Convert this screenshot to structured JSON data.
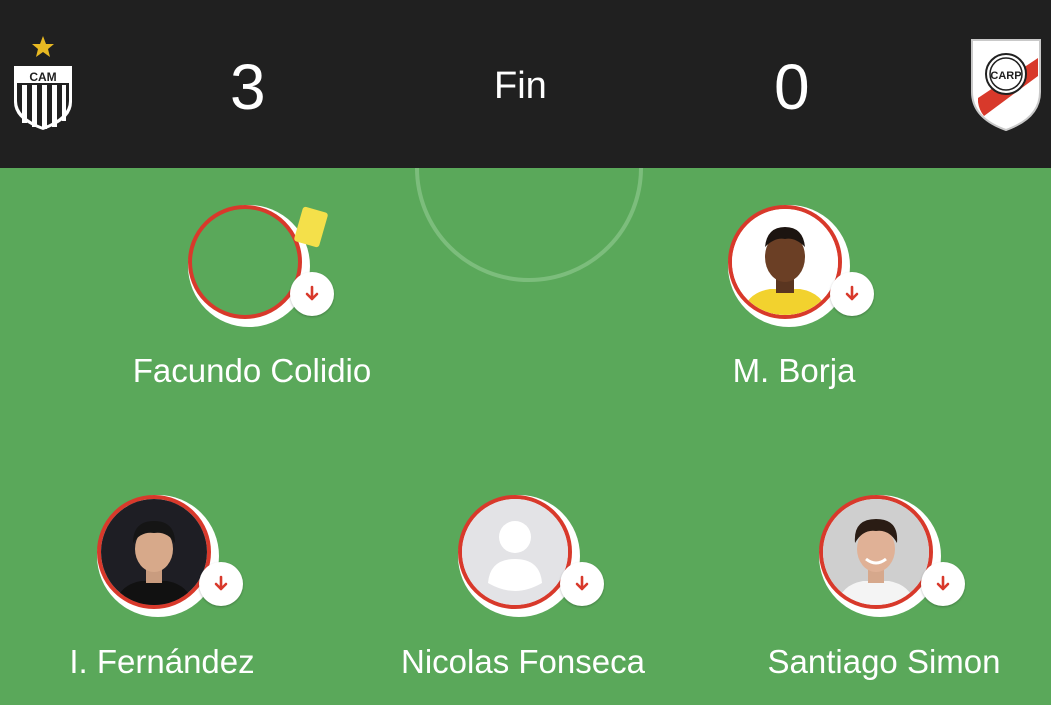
{
  "match": {
    "status": "Fin",
    "home": {
      "score": "3",
      "crest_icon": "atletico-mineiro-crest-icon",
      "crest_text": "CAM"
    },
    "away": {
      "score": "0",
      "crest_icon": "river-plate-crest-icon",
      "crest_text": "CARP"
    }
  },
  "players": [
    {
      "name": "Facundo Colidio",
      "photo": "none",
      "yellow_card": true,
      "substituted_off": true
    },
    {
      "name": "M. Borja",
      "photo": "player-photo",
      "yellow_card": false,
      "substituted_off": true
    },
    {
      "name": "I. Fernández",
      "photo": "player-photo",
      "yellow_card": false,
      "substituted_off": true
    },
    {
      "name": "Nicolas Fonseca",
      "photo": "placeholder-avatar",
      "yellow_card": false,
      "substituted_off": true
    },
    {
      "name": "Santiago Simon",
      "photo": "player-photo",
      "yellow_card": false,
      "substituted_off": true
    }
  ],
  "colors": {
    "pitch": "#5aa85a",
    "header": "#202020",
    "ring": "#d8392b",
    "yellow_card": "#f4e04a",
    "sub_arrow": "#d8392b"
  }
}
